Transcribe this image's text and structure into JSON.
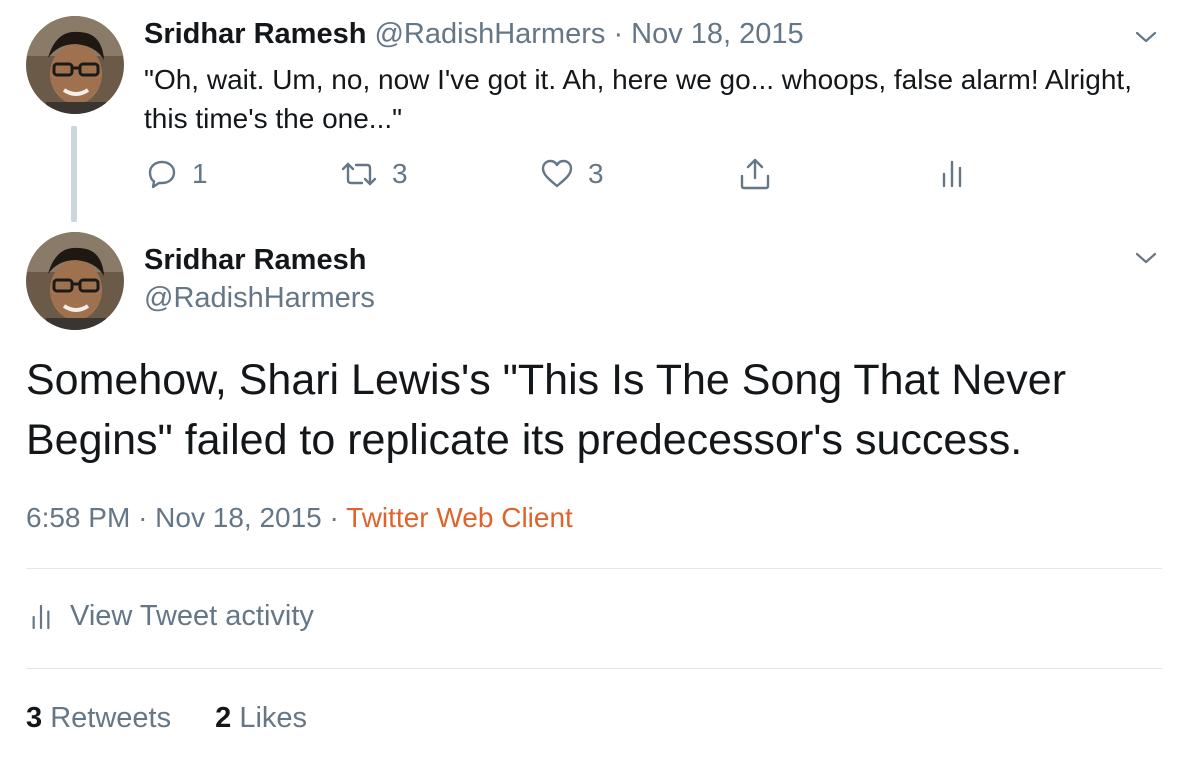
{
  "parent_tweet": {
    "display_name": "Sridhar Ramesh",
    "handle": "@RadishHarmers",
    "separator": "·",
    "date": "Nov 18, 2015",
    "text": "\"Oh, wait. Um, no, now I've got it. Ah, here we go... whoops, false alarm! Alright, this time's the one...\"",
    "actions": {
      "reply_count": "1",
      "retweet_count": "3",
      "like_count": "3"
    },
    "icons": [
      "reply-icon",
      "retweet-icon",
      "like-icon",
      "share-icon",
      "analytics-icon",
      "chevron-down-icon"
    ]
  },
  "main_tweet": {
    "display_name": "Sridhar Ramesh",
    "handle": "@RadishHarmers",
    "text": "Somehow, Shari Lewis's \"This Is The Song That Never Begins\" failed to replicate its predecessor's success.",
    "time": "6:58 PM",
    "separator": "·",
    "date": "Nov 18, 2015",
    "source": "Twitter Web Client",
    "activity_label": "View Tweet activity",
    "retweets": {
      "count": "3",
      "label": "Retweets"
    },
    "likes": {
      "count": "2",
      "label": "Likes"
    }
  },
  "colors": {
    "text_primary": "#14171a",
    "text_muted": "#657786",
    "source_link": "#e0632c",
    "divider": "#e1e8ed",
    "thread_line": "#ccd6dd"
  }
}
